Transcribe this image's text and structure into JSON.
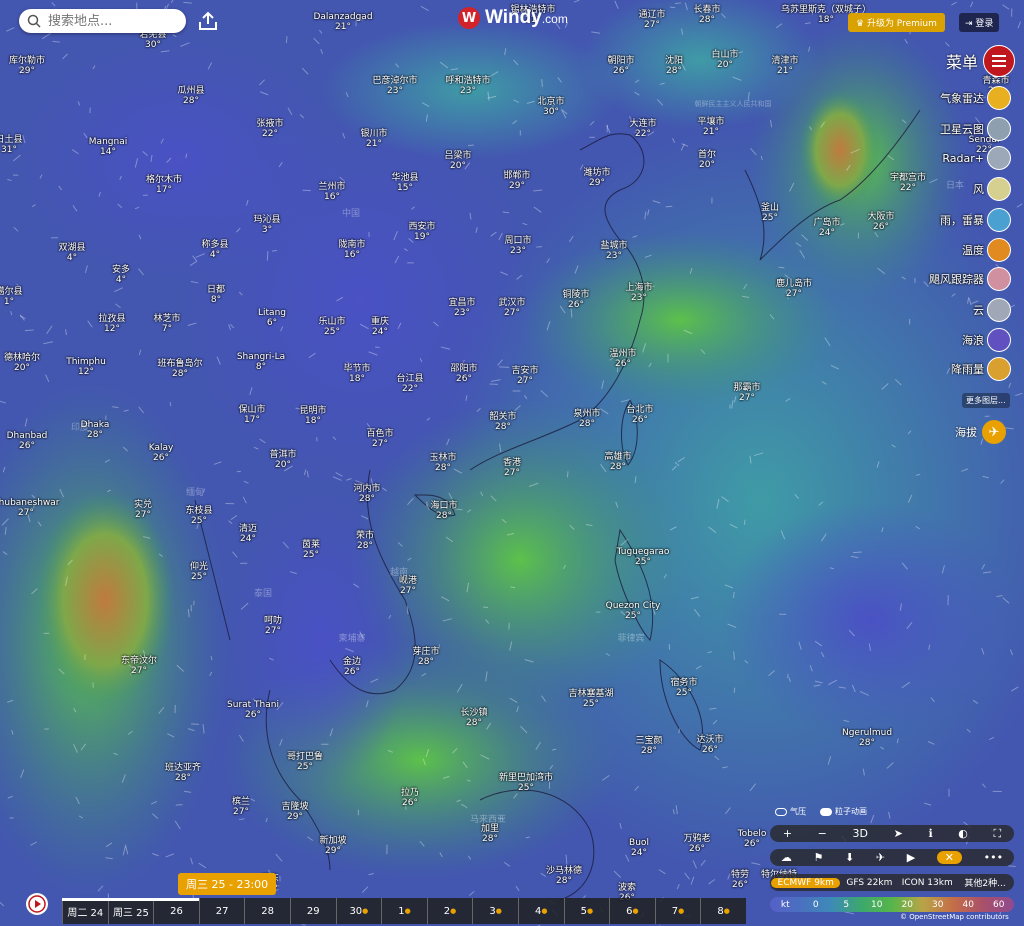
{
  "search": {
    "placeholder": "搜索地点..."
  },
  "brand": {
    "name": "Windy",
    "suffix": ".com"
  },
  "header": {
    "premium_label": "升级为 Premium",
    "login_label": "登录",
    "menu_label": "菜单"
  },
  "layers": [
    {
      "label": "气象雷达",
      "icon": "radar-icon"
    },
    {
      "label": "卫星云图",
      "icon": "satellite-icon"
    },
    {
      "label": "Radar+",
      "icon": "radar-plus-icon"
    },
    {
      "label": "风",
      "icon": "wind-icon"
    },
    {
      "label": "雨，雷暴",
      "icon": "rain-icon"
    },
    {
      "label": "温度",
      "icon": "temperature-icon"
    },
    {
      "label": "飓风跟踪器",
      "icon": "hurricane-icon"
    },
    {
      "label": "云",
      "icon": "clouds-icon"
    },
    {
      "label": "海浪",
      "icon": "waves-icon"
    },
    {
      "label": "降雨量",
      "icon": "precip-icon"
    }
  ],
  "more_layers": "更多图层...",
  "altitude_label": "海拔",
  "toggles": {
    "pressure": "气压",
    "particles": "粒子动画"
  },
  "zoom_bar": [
    "+",
    "−",
    "3D",
    "➤",
    "ℹ",
    "◐",
    "⛶"
  ],
  "tools_bar": [
    "☁",
    "⚑",
    "⬇",
    "✈",
    "▶",
    "✕",
    "•••"
  ],
  "models": [
    "ECMWF 9km",
    "GFS 22km",
    "ICON 13km",
    "其他2种..."
  ],
  "legend": {
    "unit": "kt",
    "values": [
      "0",
      "5",
      "10",
      "20",
      "30",
      "40",
      "60"
    ]
  },
  "attribution": "© OpenStreetMap contributors",
  "time_pill": "周三 25 - 23:00",
  "timeline": {
    "days": [
      "周二 24",
      "周三 25",
      "26",
      "27",
      "28",
      "29",
      "30",
      "1",
      "2",
      "3",
      "4",
      "5",
      "6",
      "7",
      "8"
    ],
    "progress_fraction": 0.2
  },
  "cities": [
    {
      "name": "Dalanzadgad",
      "t": "21°"
    },
    {
      "name": "锡林浩特市",
      "t": "21°"
    },
    {
      "name": "通辽市",
      "t": "27°"
    },
    {
      "name": "长春市",
      "t": "28°"
    },
    {
      "name": "乌苏里斯克（双城子）",
      "t": "18°"
    },
    {
      "name": "库尔勒市",
      "t": "29°"
    },
    {
      "name": "若羌县",
      "t": "30°"
    },
    {
      "name": "巴彦淖尔市",
      "t": "23°"
    },
    {
      "name": "呼和浩特市",
      "t": "23°"
    },
    {
      "name": "朝阳市",
      "t": "26°"
    },
    {
      "name": "沈阳",
      "t": "28°"
    },
    {
      "name": "白山市",
      "t": "20°"
    },
    {
      "name": "清津市",
      "t": "21°"
    },
    {
      "name": "瓜州县",
      "t": "28°"
    },
    {
      "name": "北京市",
      "t": "30°"
    },
    {
      "name": "青森市",
      "t": "22°"
    },
    {
      "name": "张掖市",
      "t": "22°"
    },
    {
      "name": "银川市",
      "t": "21°"
    },
    {
      "name": "大连市",
      "t": "22°"
    },
    {
      "name": "平壤市",
      "t": "21°"
    },
    {
      "name": "Mangnai",
      "t": "14°"
    },
    {
      "name": "吕梁市",
      "t": "20°"
    },
    {
      "name": "首尔",
      "t": "20°"
    },
    {
      "name": "Sendai",
      "t": "22°"
    },
    {
      "name": "格尔木市",
      "t": "17°"
    },
    {
      "name": "兰州市",
      "t": "16°"
    },
    {
      "name": "华池县",
      "t": "15°"
    },
    {
      "name": "邯郸市",
      "t": "29°"
    },
    {
      "name": "潍坊市",
      "t": "29°"
    },
    {
      "name": "宇都宫市",
      "t": "22°"
    },
    {
      "name": "日土县",
      "t": "31°"
    },
    {
      "name": "釜山",
      "t": "25°"
    },
    {
      "name": "玛沁县",
      "t": "3°"
    },
    {
      "name": "西安市",
      "t": "19°"
    },
    {
      "name": "广岛市",
      "t": "24°"
    },
    {
      "name": "大阪市",
      "t": "26°"
    },
    {
      "name": "双湖县",
      "t": "4°"
    },
    {
      "name": "称多县",
      "t": "4°"
    },
    {
      "name": "陇南市",
      "t": "16°"
    },
    {
      "name": "周口市",
      "t": "23°"
    },
    {
      "name": "盐城市",
      "t": "23°"
    },
    {
      "name": "安多",
      "t": "4°"
    },
    {
      "name": "鹿儿岛市",
      "t": "27°"
    },
    {
      "name": "日都",
      "t": "8°"
    },
    {
      "name": "宜昌市",
      "t": "23°"
    },
    {
      "name": "武汉市",
      "t": "27°"
    },
    {
      "name": "铜陵市",
      "t": "26°"
    },
    {
      "name": "上海市",
      "t": "23°"
    },
    {
      "name": "噶尔县",
      "t": "1°"
    },
    {
      "name": "拉孜县",
      "t": "12°"
    },
    {
      "name": "林芝市",
      "t": "7°"
    },
    {
      "name": "Litang",
      "t": "6°"
    },
    {
      "name": "乐山市",
      "t": "25°"
    },
    {
      "name": "重庆",
      "t": "24°"
    },
    {
      "name": "Thimphu",
      "t": "12°"
    },
    {
      "name": "德林哈尔",
      "t": "20°"
    },
    {
      "name": "Shangri-La",
      "t": "8°"
    },
    {
      "name": "毕节市",
      "t": "18°"
    },
    {
      "name": "邵阳市",
      "t": "26°"
    },
    {
      "name": "吉安市",
      "t": "27°"
    },
    {
      "name": "温州市",
      "t": "26°"
    },
    {
      "name": "班布鲁岛尔",
      "t": "28°"
    },
    {
      "name": "台江县",
      "t": "22°"
    },
    {
      "name": "那霸市",
      "t": "27°"
    },
    {
      "name": "保山市",
      "t": "17°"
    },
    {
      "name": "昆明市",
      "t": "18°"
    },
    {
      "name": "韶关市",
      "t": "28°"
    },
    {
      "name": "泉州市",
      "t": "28°"
    },
    {
      "name": "台北市",
      "t": "26°"
    },
    {
      "name": "Dhaka",
      "t": "28°"
    },
    {
      "name": "Dhanbad",
      "t": "26°"
    },
    {
      "name": "百色市",
      "t": "27°"
    },
    {
      "name": "Kalay",
      "t": "26°"
    },
    {
      "name": "普洱市",
      "t": "20°"
    },
    {
      "name": "玉林市",
      "t": "28°"
    },
    {
      "name": "香港",
      "t": "27°"
    },
    {
      "name": "高雄市",
      "t": "28°"
    },
    {
      "name": "河内市",
      "t": "28°"
    },
    {
      "name": "Bhubaneshwar",
      "t": "27°"
    },
    {
      "name": "实兑",
      "t": "27°"
    },
    {
      "name": "东枝县",
      "t": "25°"
    },
    {
      "name": "海口市",
      "t": "28°"
    },
    {
      "name": "清迈",
      "t": "24°"
    },
    {
      "name": "荣市",
      "t": "28°"
    },
    {
      "name": "Tuguegarao",
      "t": "25°"
    },
    {
      "name": "茵莱",
      "t": "25°"
    },
    {
      "name": "仰光",
      "t": "25°"
    },
    {
      "name": "岘港",
      "t": "27°"
    },
    {
      "name": "Quezon City",
      "t": "25°"
    },
    {
      "name": "呵叻",
      "t": "27°"
    },
    {
      "name": "芽庄市",
      "t": "28°"
    },
    {
      "name": "东帝汶尔",
      "t": "27°"
    },
    {
      "name": "金边",
      "t": "26°"
    },
    {
      "name": "宿务市",
      "t": "25°"
    },
    {
      "name": "Surat Thani",
      "t": "26°"
    },
    {
      "name": "长沙镇",
      "t": "28°"
    },
    {
      "name": "吉林塞基湖",
      "t": "25°"
    },
    {
      "name": "哥打巴鲁",
      "t": "25°"
    },
    {
      "name": "三宝颜",
      "t": "28°"
    },
    {
      "name": "达沃市",
      "t": "26°"
    },
    {
      "name": "Ngerulmud",
      "t": "28°"
    },
    {
      "name": "班达亚齐",
      "t": "28°"
    },
    {
      "name": "新里巴加湾市",
      "t": "25°"
    },
    {
      "name": "槟兰",
      "t": "27°"
    },
    {
      "name": "吉隆坡",
      "t": "29°"
    },
    {
      "name": "拉乃",
      "t": "26°"
    },
    {
      "name": "新加坡",
      "t": "29°"
    },
    {
      "name": "加里",
      "t": "28°"
    },
    {
      "name": "Buol",
      "t": "24°"
    },
    {
      "name": "万鸦老",
      "t": "26°"
    },
    {
      "name": "Tobelo",
      "t": "26°"
    },
    {
      "name": "特劳",
      "t": "26°"
    },
    {
      "name": "巴东",
      "t": "26°"
    },
    {
      "name": "沙马林德",
      "t": "28°"
    },
    {
      "name": "波索",
      "t": "26°"
    },
    {
      "name": "特尔纳特",
      "t": "28°"
    }
  ],
  "countries": [
    "中国",
    "日本",
    "朝鲜民主主义人民共和国",
    "缅甸",
    "泰国",
    "越南",
    "柬埔寨",
    "菲律宾",
    "马来西亚",
    "印度"
  ]
}
